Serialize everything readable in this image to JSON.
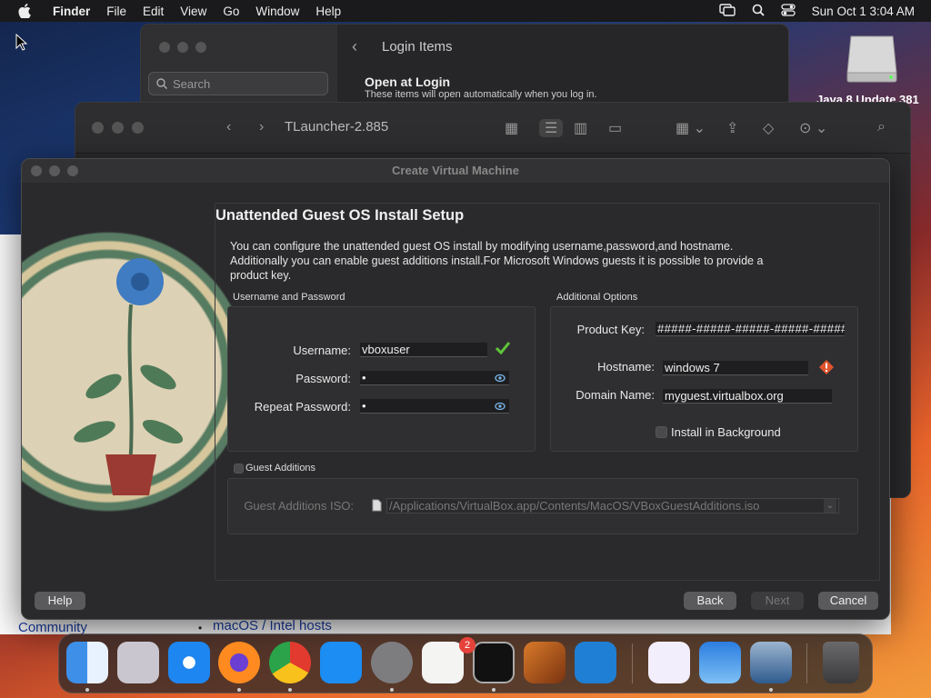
{
  "menubar": {
    "app": "Finder",
    "items": [
      "File",
      "Edit",
      "View",
      "Go",
      "Window",
      "Help"
    ],
    "datetime": "Sun Oct 1  3:04 AM"
  },
  "login_window": {
    "search_placeholder": "Search",
    "title": "Login Items",
    "heading": "Open at Login",
    "subtitle": "These items will open automatically when you log in."
  },
  "desktop": {
    "drive_label": "Java 8 Update 381"
  },
  "finder_window": {
    "title": "TLauncher-2.885"
  },
  "browser": {
    "community": "Community",
    "link": "macOS / Intel hosts"
  },
  "dialog": {
    "title": "Create Virtual Machine",
    "heading": "Unattended Guest OS Install Setup",
    "description": "You can configure the unattended guest OS install by modifying username,password,and hostname. Additionally you can enable guest additions install.For Microsoft Windows guests it is possible to provide a product key.",
    "user_group": "Username and Password",
    "username_label": "Username:",
    "username": "vboxuser",
    "password_label": "Password:",
    "password": "•",
    "repeat_label": "Repeat Password:",
    "repeat": "•",
    "options_group": "Additional Options",
    "product_key_label": "Product Key:",
    "product_key": "#####-#####-#####-#####-#####",
    "hostname_label": "Hostname:",
    "hostname": "windows 7",
    "domain_label": "Domain Name:",
    "domain": "myguest.virtualbox.org",
    "install_bg": "Install in Background",
    "ga_group": "Guest Additions",
    "ga_iso_label": "Guest Additions ISO:",
    "ga_iso": "/Applications/VirtualBox.app/Contents/MacOS/VBoxGuestAdditions.iso",
    "buttons": {
      "help": "Help",
      "back": "Back",
      "next": "Next",
      "cancel": "Cancel"
    }
  },
  "dock": {
    "settings_badge": "2",
    "apps": [
      "finder-icon",
      "launchpad-icon",
      "safari-icon",
      "firefox-icon",
      "chrome-icon",
      "app-store-icon",
      "system-settings-icon",
      "textedit-icon",
      "terminal-icon",
      "garageband-icon",
      "vscode-icon",
      "visual-studio-icon",
      "weather-icon",
      "virtualbox-icon",
      "trash-icon"
    ]
  }
}
